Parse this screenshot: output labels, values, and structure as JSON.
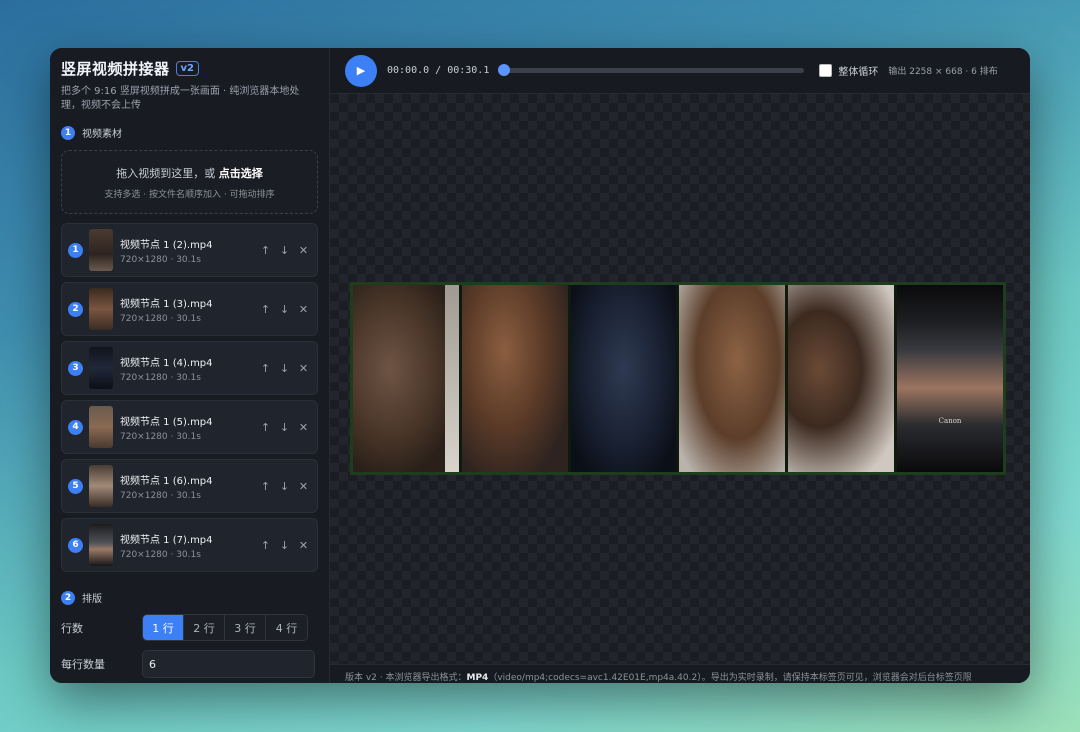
{
  "app": {
    "title": "竖屏视频拼接器",
    "version_badge": "v2",
    "subtitle": "把多个 9:16 竖屏视频拼成一张画面 · 纯浏览器本地处理，视频不会上传"
  },
  "sources": {
    "step": "1",
    "label": "视频素材",
    "dropzone": {
      "prompt": "拖入视频到这里，或",
      "link": "点击选择",
      "hint": "支持多选 · 按文件名顺序加入 · 可拖动排序"
    },
    "files": [
      {
        "index": "1",
        "name": "视频节点 1 (2).mp4",
        "info": "720×1280 · 30.1s"
      },
      {
        "index": "2",
        "name": "视频节点 1 (3).mp4",
        "info": "720×1280 · 30.1s"
      },
      {
        "index": "3",
        "name": "视频节点 1 (4).mp4",
        "info": "720×1280 · 30.1s"
      },
      {
        "index": "4",
        "name": "视频节点 1 (5).mp4",
        "info": "720×1280 · 30.1s"
      },
      {
        "index": "5",
        "name": "视频节点 1 (6).mp4",
        "info": "720×1280 · 30.1s"
      },
      {
        "index": "6",
        "name": "视频节点 1 (7).mp4",
        "info": "720×1280 · 30.1s"
      }
    ],
    "actions": {
      "up": "↑",
      "down": "↓",
      "remove": "✕"
    }
  },
  "layout": {
    "step": "2",
    "label": "排版",
    "rows_label": "行数",
    "rows_options": [
      "1 行",
      "2 行",
      "3 行",
      "4 行"
    ],
    "rows_selected": "1 行",
    "per_row_label": "每行数量",
    "per_row_value": "6"
  },
  "player": {
    "play_icon": "▶",
    "time": "00:00.0 / 00:30.1",
    "progress": 0,
    "loop_label": "整体循环",
    "loop_checked": false,
    "output_info": "输出 2258 × 668 · 6 排布"
  },
  "preview": {
    "camera_brand": "Canon"
  },
  "footer": {
    "prefix": "版本 v2 · 本浏览器导出格式：",
    "format": "MP4",
    "suffix": "（video/mp4;codecs=avc1.42E01E,mp4a.40.2）。导出为实时录制，请保持本标签页可见，浏览器会对后台标签页限"
  },
  "colors": {
    "accent": "#3d7ff5",
    "panel": "#181b22",
    "preview_border": "#1d3d1c"
  }
}
